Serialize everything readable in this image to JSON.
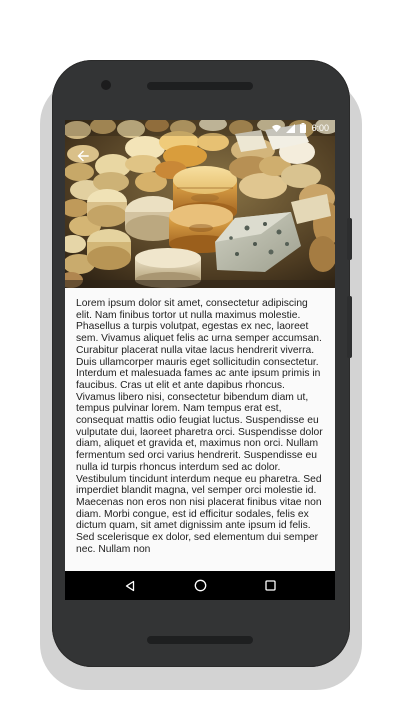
{
  "status_bar": {
    "time": "6:00",
    "icons": [
      "wifi-icon",
      "signal-icon",
      "battery-icon"
    ]
  },
  "toolbar": {
    "back_icon": "arrow-back-icon"
  },
  "hero_image": {
    "subject": "cheese-display-photo"
  },
  "article": {
    "body": "Lorem ipsum dolor sit amet, consectetur adipiscing elit. Nam finibus tortor ut nulla maximus molestie. Phasellus a turpis volutpat, egestas ex nec, laoreet sem. Vivamus aliquet felis ac urna semper accumsan. Curabitur placerat nulla vitae lacus hendrerit viverra. Duis ullamcorper mauris eget sollicitudin consectetur. Interdum et malesuada fames ac ante ipsum primis in faucibus. Cras ut elit et ante dapibus rhoncus. Vivamus libero nisi, consectetur bibendum diam ut, tempus pulvinar lorem. Nam tempus erat est, consequat mattis odio feugiat luctus. Suspendisse eu vulputate dui, laoreet pharetra orci. Suspendisse dolor diam, aliquet et gravida et, maximus non orci. Nullam fermentum sed orci varius hendrerit. Suspendisse eu nulla id turpis rhoncus interdum sed ac dolor. Vestibulum tincidunt interdum neque eu pharetra. Sed imperdiet blandit magna, vel semper orci molestie id. Maecenas non eros non nisi placerat finibus vitae non diam. Morbi congue, est id efficitur sodales, felis ex dictum quam, sit amet dignissim ante ipsum id felis. Sed scelerisque ex dolor, sed elementum dui semper nec. Nullam non"
  },
  "nav_bar": {
    "back_icon": "nav-back-icon",
    "home_icon": "nav-home-icon",
    "recents_icon": "nav-recents-icon"
  },
  "colors": {
    "phone_body": "#333435",
    "phone_shadow": "#d3d3d3",
    "content_background": "#fafafa",
    "nav_bar": "#000000"
  }
}
